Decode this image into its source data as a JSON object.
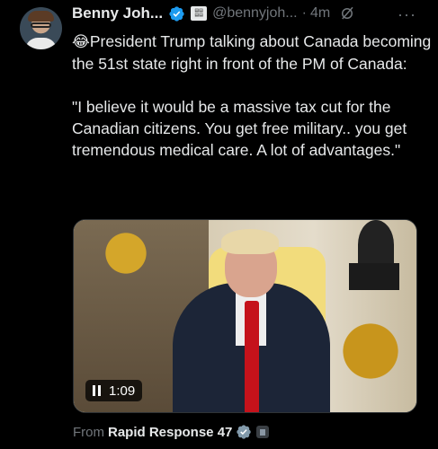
{
  "post": {
    "author_name": "Benny Joh...",
    "handle": "@bennyjoh...",
    "separator": "·",
    "time": "4m",
    "more": "···",
    "text_line1": "President Trump talking about Canada becoming the 51st state right in front of the PM of Canada:",
    "emoji": "😂",
    "text_quote": "\"I believe it would be a massive tax cut for the Canadian citizens. You get free military.. you get tremendous medical care. A lot of advantages.\""
  },
  "video": {
    "duration": "1:09"
  },
  "source": {
    "label": "From",
    "name": "Rapid Response 47"
  },
  "colors": {
    "background": "#000000",
    "text": "#e7e9ea",
    "secondary": "#71767b",
    "verified_blue": "#1d9bf0",
    "verified_gray": "#829aab"
  },
  "icons": [
    "verified-badge-icon",
    "affiliate-badge-icon",
    "grok-icon",
    "more-icon",
    "pause-icon",
    "government-badge-icon"
  ]
}
